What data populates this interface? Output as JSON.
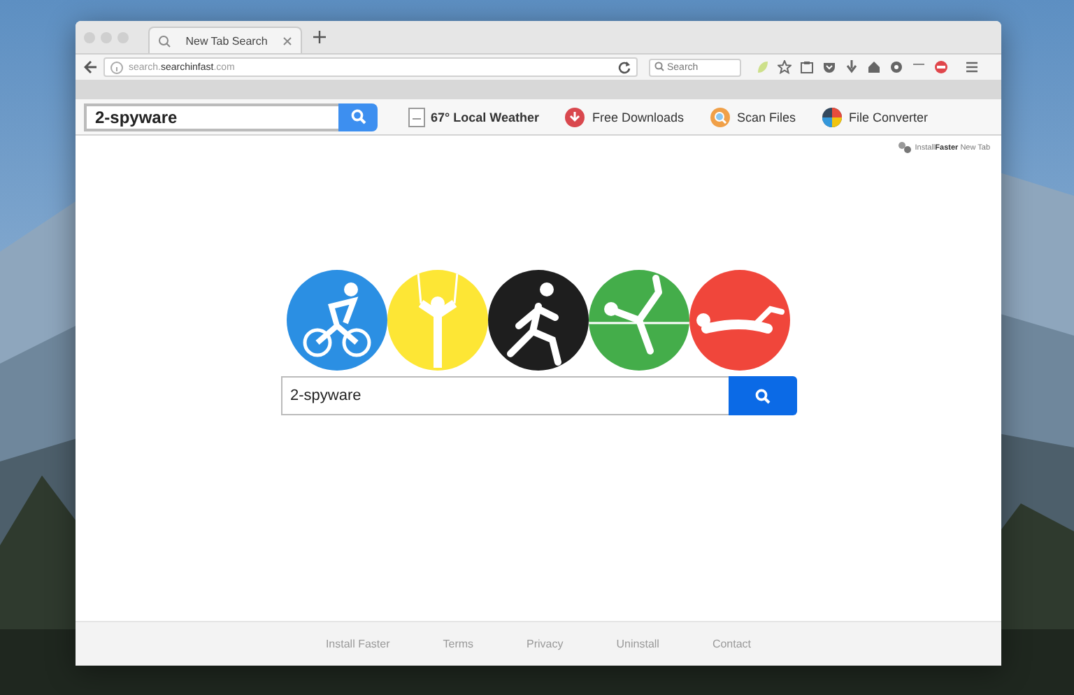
{
  "browser": {
    "tabs": [
      {
        "title": "New Tab Search",
        "selected": true
      }
    ],
    "address": "search.**searchinfast**.com",
    "search_placeholder": "Search"
  },
  "toolbar": {
    "search_value": "2-spyware",
    "weather": "67° Local Weather",
    "links": [
      {
        "kind": "download",
        "label": "Free Downloads"
      },
      {
        "kind": "scan",
        "label": "Scan Files"
      },
      {
        "kind": "convert",
        "label": "File Converter"
      }
    ]
  },
  "logo": "Install**Faster** New Tab",
  "sports": [
    {
      "kind": "cycling",
      "color": "#2b8fe3"
    },
    {
      "kind": "rings",
      "color": "#fde635"
    },
    {
      "kind": "running",
      "color": "#1e1e1e"
    },
    {
      "kind": "highjump",
      "color": "#44ad4a"
    },
    {
      "kind": "swimming",
      "color": "#f0463b"
    }
  ],
  "search": {
    "value": "2-spyware"
  },
  "footer": [
    "Install Faster",
    "Terms",
    "Privacy",
    "Uninstall",
    "Contact"
  ]
}
